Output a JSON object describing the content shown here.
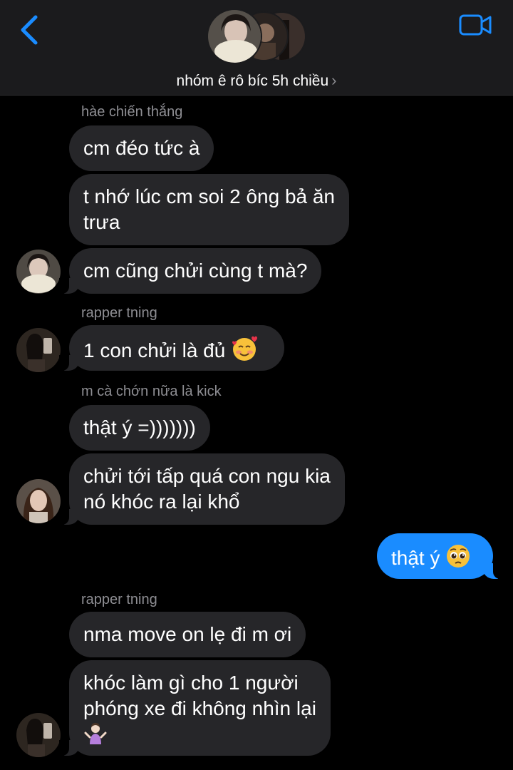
{
  "header": {
    "group_name": "nhóm ê rô bíc 5h chiều",
    "chevron": "›"
  },
  "messages": [
    {
      "sender": "hàe chiến thắng",
      "text": "cm đéo tức à"
    },
    {
      "text_line1": "t nhớ lúc cm soi 2 ông bả ăn",
      "text_line2": "trưa"
    },
    {
      "text": "cm cũng chửi cùng t mà?"
    },
    {
      "sender": "rapper tning",
      "text": "1 con chửi là đủ",
      "emoji": "smiling-face-with-hearts"
    },
    {
      "sender": "m cà chớn nữa là kick",
      "text": "thật ý =)))))))"
    },
    {
      "text_line1": "chửi tới tấp quá con ngu kia",
      "text_line2": "nó khóc ra lại khổ"
    },
    {
      "text": "thật ý",
      "emoji": "pleading-face",
      "from_me": true
    },
    {
      "sender": "rapper tning",
      "text": "nma move on lẹ đi m ơi"
    },
    {
      "text_line1": "khóc làm gì cho 1 người",
      "text_line2": "phóng xe đi không nhìn lại",
      "emoji": "person-shrugging"
    }
  ],
  "colors": {
    "incoming_bubble": "#262629",
    "outgoing_bubble": "#1a8cff",
    "accent": "#1a8cff",
    "header_bg": "#1b1b1d"
  }
}
